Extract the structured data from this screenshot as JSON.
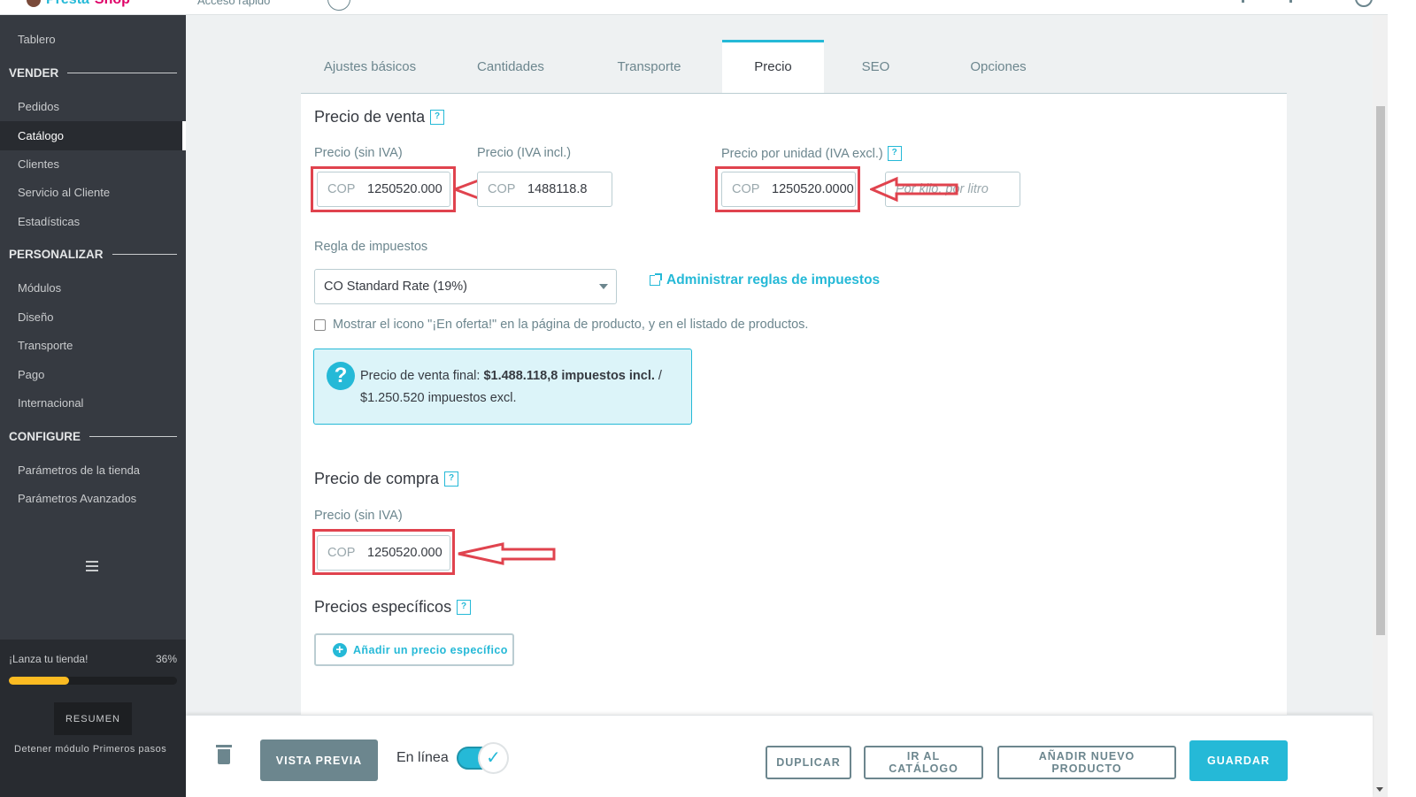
{
  "header": {
    "logo_text_a": "Presta",
    "logo_text_b": "Shop",
    "quick_access": "Acceso rápido"
  },
  "sidebar": {
    "items": [
      {
        "label": "Tablero"
      },
      {
        "label": "Pedidos"
      },
      {
        "label": "Catálogo"
      },
      {
        "label": "Clientes"
      },
      {
        "label": "Servicio al Cliente"
      },
      {
        "label": "Estadísticas"
      },
      {
        "label": "Módulos"
      },
      {
        "label": "Diseño"
      },
      {
        "label": "Transporte"
      },
      {
        "label": "Pago"
      },
      {
        "label": "Internacional"
      },
      {
        "label": "Parámetros de la tienda"
      },
      {
        "label": "Parámetros Avanzados"
      }
    ],
    "sections": [
      "VENDER",
      "PERSONALIZAR",
      "CONFIGURE"
    ],
    "active_item": "Catálogo",
    "onboarding": {
      "label": "¡Lanza tu tienda!",
      "percent_text": "36%",
      "progress": 0.36,
      "resume_label": "RESUMEN",
      "stop_label": "Detener módulo Primeros pasos"
    }
  },
  "tabs": {
    "items": [
      {
        "label": "Ajustes básicos"
      },
      {
        "label": "Cantidades"
      },
      {
        "label": "Transporte"
      },
      {
        "label": "Precio"
      },
      {
        "label": "SEO"
      },
      {
        "label": "Opciones"
      }
    ],
    "active": "Precio"
  },
  "sale_price": {
    "heading": "Precio de venta",
    "price_excl_label": "Precio (sin IVA)",
    "price_excl_currency": "COP",
    "price_excl_value": "1250520.000",
    "price_incl_label": "Precio (IVA incl.)",
    "price_incl_currency": "COP",
    "price_incl_value": "1488118.8",
    "unit_price_label": "Precio por unidad (IVA excl.)",
    "unit_price_currency": "COP",
    "unit_price_value": "1250520.0000",
    "unit_placeholder": "Por kilo, por litro"
  },
  "tax": {
    "label": "Regla de impuestos",
    "selected": "CO Standard Rate (19%)",
    "manage_link": "Administrar reglas de impuestos"
  },
  "on_sale": {
    "checked": false,
    "label": "Mostrar el icono \"¡En oferta!\" en la página de producto, y en el listado de productos."
  },
  "info": {
    "prefix": "Precio de venta final: ",
    "bold": "$1.488.118,8 impuestos incl.",
    "suffix": " /",
    "line2": "$1.250.520 impuestos excl."
  },
  "purchase_price": {
    "heading": "Precio de compra",
    "label": "Precio (sin IVA)",
    "currency": "COP",
    "value": "1250520.000"
  },
  "specific_prices": {
    "heading": "Precios específicos",
    "add_label": "Añadir un precio específico"
  },
  "help_glyph": "?",
  "footer": {
    "preview_label": "VISTA PREVIA",
    "online_label": "En línea",
    "online_enabled": true,
    "duplicate_label": "DUPLICAR",
    "catalog_label": "IR AL CATÁLOGO",
    "new_product_label": "AÑADIR NUEVO PRODUCTO",
    "save_label": "GUARDAR"
  },
  "colors": {
    "accent": "#25b9d7",
    "sidebar_bg": "#363a41",
    "highlight_annotation": "#e0434e",
    "progress": "#fbbb22"
  }
}
